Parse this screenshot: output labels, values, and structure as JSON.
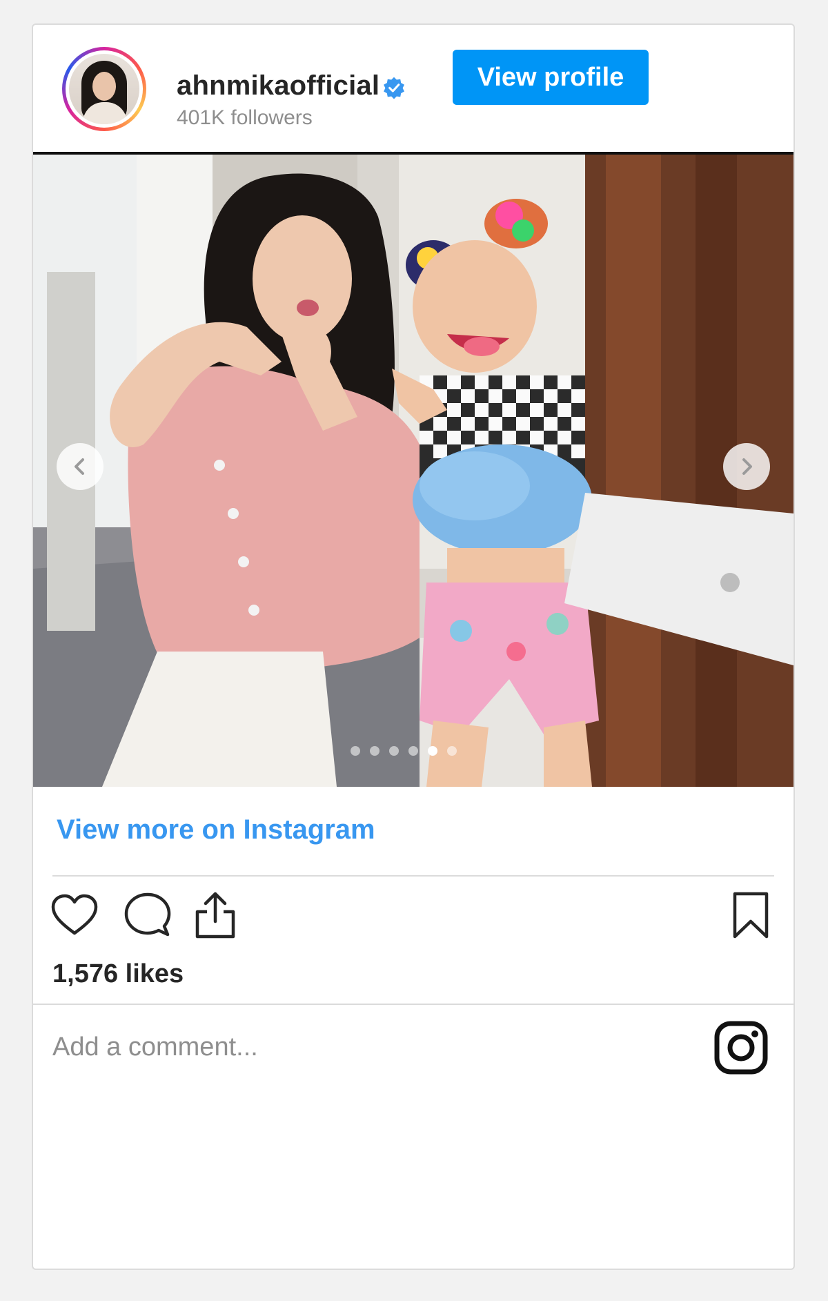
{
  "post": {
    "username": "ahnmikaofficial",
    "followers": "401K followers",
    "view_profile_label": "View profile",
    "view_more_label": "View more on Instagram",
    "likes": "1,576 likes",
    "comment_placeholder": "Add a comment...",
    "carousel": {
      "total_slides": 6,
      "active_slide": 5
    }
  },
  "icons": {
    "verified": "verified-badge-icon",
    "prev": "chevron-left-icon",
    "next": "chevron-right-icon",
    "like": "heart-icon",
    "comment": "comment-icon",
    "share": "share-icon",
    "save": "bookmark-icon",
    "logo": "instagram-logo-icon"
  },
  "colors": {
    "button": "#0095f6",
    "link": "#3897f0",
    "verified": "#3897f0",
    "text": "#262626",
    "muted": "#8e8e8e"
  }
}
